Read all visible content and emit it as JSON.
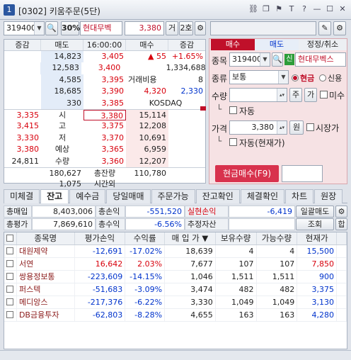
{
  "window": {
    "number": "1",
    "title": "[0302] 키움주문(5단)"
  },
  "toolbar": {
    "code": "319400",
    "pct_label": "30%",
    "stock_name": "현대무벡",
    "price": "3,380",
    "mode1": "거",
    "mode2": "2호"
  },
  "book": {
    "headers": [
      "증감",
      "매도",
      "16:00:00",
      "매수",
      "증감"
    ],
    "asks": [
      {
        "left_delta": "",
        "qty": "14,823",
        "price": "3,405",
        "right": "▲ 55",
        "right2": "+1.65%"
      },
      {
        "left_delta": "",
        "qty": "12,583",
        "price": "3,400",
        "right": "",
        "right2": "1,334,688"
      },
      {
        "left_delta": "",
        "qty": "4,585",
        "price": "3,395",
        "right": "거래비용",
        "right2": "8"
      },
      {
        "left_delta": "",
        "qty": "18,685",
        "price": "3,390",
        "right": "4,320",
        "right2": "2,330"
      },
      {
        "left_delta": "",
        "qty": "330",
        "price": "3,385",
        "right": "KOSDAQ",
        "right2": ""
      }
    ],
    "bids": [
      {
        "left": "3,335",
        "label": "시",
        "price": "3,380",
        "qty": "15,114"
      },
      {
        "left": "3,415",
        "label": "고",
        "price": "3,375",
        "qty": "12,208"
      },
      {
        "left": "3,330",
        "label": "저",
        "price": "3,370",
        "qty": "10,691"
      },
      {
        "left": "3,380",
        "label": "예상",
        "price": "3,365",
        "qty": "6,959"
      },
      {
        "left": "24,811",
        "label": "수량",
        "price": "3,360",
        "qty": "12,207"
      }
    ],
    "total_ask": "180,627",
    "total_label": "총잔량",
    "total_bid": "110,780",
    "after_qty": "1,075",
    "after_label": "시간외"
  },
  "order": {
    "tabs": [
      "매수",
      "매도",
      "정정/취소"
    ],
    "code_label": "종목",
    "code": "319400",
    "credit_badge": "신",
    "stock_name": "현대무벡스",
    "type_label": "종류",
    "type_value": "보통",
    "cash_label": "현금",
    "credit_label": "신용",
    "qty_label": "수량",
    "qty_btn1": "주",
    "qty_btn2": "가",
    "unfilled_label": "미수",
    "auto_label": "자동",
    "price_label": "가격",
    "price_value": "3,380",
    "won_label": "원",
    "market_label": "시장가",
    "auto_price_label": "자동(현재가)",
    "submit_label": "현금매수(F9)"
  },
  "tabs2": [
    "미체결",
    "잔고",
    "예수금",
    "당일매매",
    "주문가능",
    "잔고확인",
    "체결확인",
    "차트",
    "원장"
  ],
  "summary": {
    "buy_total_label": "총매입",
    "buy_total": "8,403,006",
    "pl_label": "총손익",
    "pl": "-551,520",
    "realized_label": "실현손익",
    "realized": "-6,419",
    "batch_sell": "일괄매도",
    "eval_label": "총평가",
    "eval": "7,869,610",
    "rate_label": "총수익률",
    "rate": "-6.56%",
    "est_label": "추정자산",
    "est": "",
    "query": "조회",
    "sum": "합"
  },
  "holdings": {
    "headers": [
      "",
      "종목명",
      "평가손익",
      "수익률",
      "매 입 가",
      "보유수량",
      "가능수량",
      "현재가"
    ],
    "rows": [
      {
        "name": "대원제약",
        "pl": "-12,691",
        "rate": "-17.02%",
        "buy": "18,639",
        "hold": "4",
        "avail": "4",
        "cur": "15,500",
        "up": false
      },
      {
        "name": "서연",
        "pl": "16,642",
        "rate": "2.03%",
        "buy": "7,677",
        "hold": "107",
        "avail": "107",
        "cur": "7,850",
        "up": true
      },
      {
        "name": "쌍용정보통",
        "pl": "-223,609",
        "rate": "-14.15%",
        "buy": "1,046",
        "hold": "1,511",
        "avail": "1,511",
        "cur": "900",
        "up": false
      },
      {
        "name": "퍼스텍",
        "pl": "-51,683",
        "rate": "-3.09%",
        "buy": "3,474",
        "hold": "482",
        "avail": "482",
        "cur": "3,375",
        "up": false
      },
      {
        "name": "메디앙스",
        "pl": "-217,376",
        "rate": "-6.22%",
        "buy": "3,330",
        "hold": "1,049",
        "avail": "1,049",
        "cur": "3,130",
        "up": false
      },
      {
        "name": "DB금융투자",
        "pl": "-62,803",
        "rate": "-8.28%",
        "buy": "4,655",
        "hold": "163",
        "avail": "163",
        "cur": "4,280",
        "up": false
      }
    ]
  }
}
